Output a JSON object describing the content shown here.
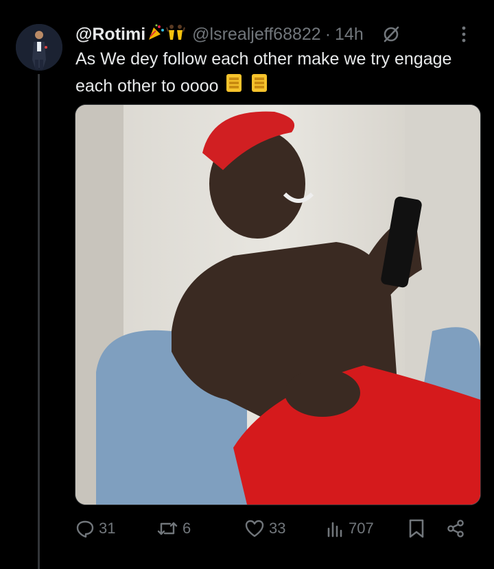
{
  "tweet": {
    "display_name": "@Rotimi",
    "handle": "@lsrealjeff68822",
    "separator": "·",
    "time": "14h",
    "text": "As We dey follow each other make we try engage each other to oooo",
    "emojis_name": [
      "party-popper-icon",
      "dancers-icon"
    ],
    "emojis_text": [
      "fist-icon",
      "fist-icon"
    ]
  },
  "actions": {
    "replies": "31",
    "reposts": "6",
    "likes": "33",
    "views": "707"
  },
  "colors": {
    "background": "#000000",
    "text": "#e7e9ea",
    "muted": "#71767b",
    "border": "#2f3336"
  }
}
